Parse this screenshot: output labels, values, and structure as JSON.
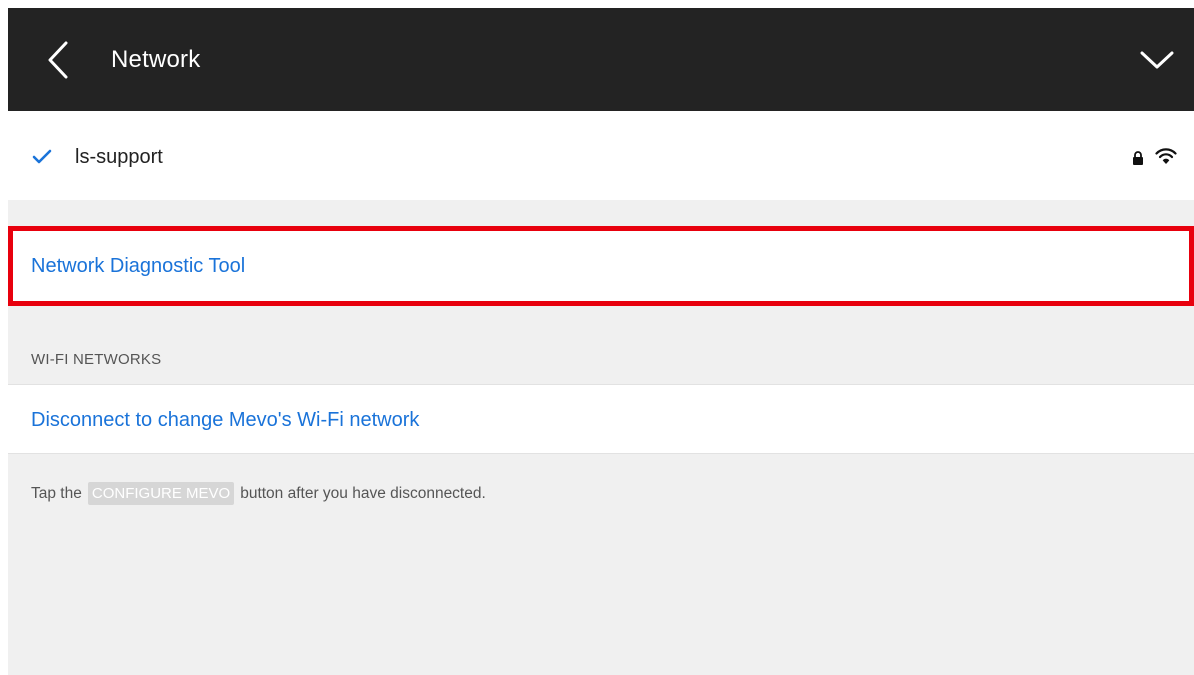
{
  "header": {
    "title": "Network",
    "back_icon": "chevron-left-icon",
    "collapse_icon": "chevron-down-icon"
  },
  "current_network": {
    "name": "ls-support",
    "connected_icon": "checkmark-icon",
    "secured_icon": "lock-icon",
    "signal_icon": "wifi-icon"
  },
  "diagnostic": {
    "label": "Network Diagnostic Tool",
    "highlight_color": "#e8000d"
  },
  "wifi_section": {
    "header": "WI-FI NETWORKS",
    "disconnect_label": "Disconnect to change Mevo's Wi-Fi network"
  },
  "hint": {
    "prefix": "Tap the",
    "badge": "CONFIGURE MEVO",
    "suffix": "button after you have disconnected."
  },
  "colors": {
    "header_bg": "#232323",
    "link": "#1a73d9",
    "background": "#f0f0f0"
  }
}
